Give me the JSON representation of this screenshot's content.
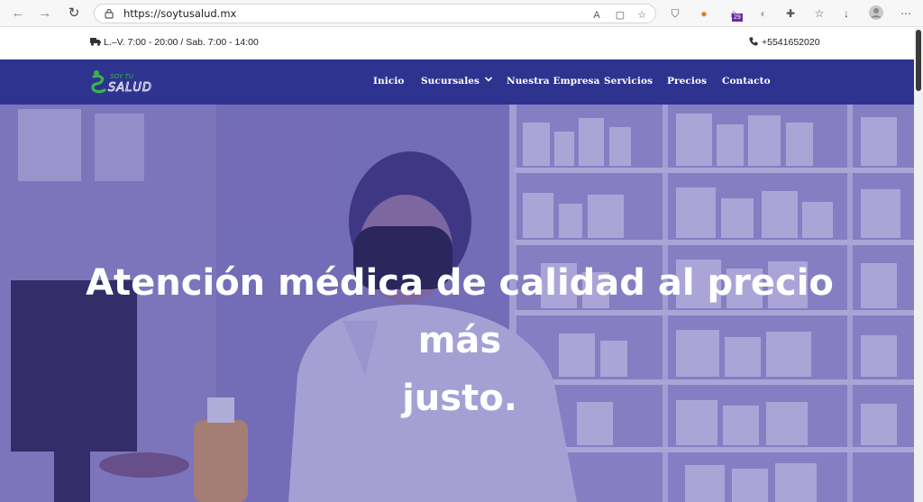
{
  "browser": {
    "url": "https://soytusalud.mx",
    "extension_badge": "29"
  },
  "info_bar": {
    "hours": "L.–V. 7:00 - 20:00 / Sab. 7:00 - 14:00",
    "phone": "+5541652020"
  },
  "navbar": {
    "logo_text_top": "SOY TU",
    "logo_text_bottom": "SALUD",
    "items": [
      {
        "label": "Inicio"
      },
      {
        "label": "Sucursales"
      },
      {
        "label": "Nuestra Empresa"
      },
      {
        "label": "Servicios"
      },
      {
        "label": "Precios"
      },
      {
        "label": "Contacto"
      }
    ]
  },
  "hero": {
    "title_line1": "Atención médica de calidad al precio más",
    "title_line2": "justo."
  },
  "colors": {
    "navbar": "#2f3390",
    "accent_green": "#39b54a",
    "hero_overlay": "#463caa"
  }
}
